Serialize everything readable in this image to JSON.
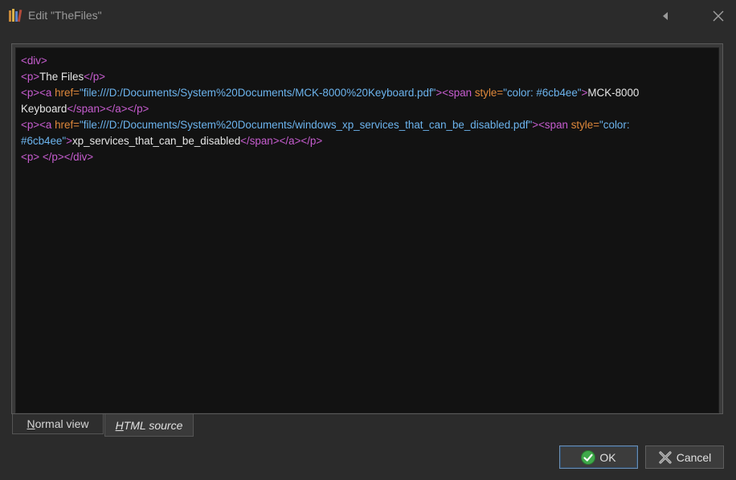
{
  "window": {
    "title": "Edit \"TheFiles\"",
    "icons": {
      "app": "bookshelf-icon",
      "collapse": "triangle-left-icon",
      "close": "close-icon"
    }
  },
  "source_lines": [
    [
      {
        "t": "tag",
        "v": "<div>"
      }
    ],
    [
      {
        "t": "tag",
        "v": "<p>"
      },
      {
        "t": "txt",
        "v": "The Files"
      },
      {
        "t": "tag",
        "v": "</p>"
      }
    ],
    [
      {
        "t": "tag",
        "v": "<p>"
      },
      {
        "t": "tag",
        "v": "<a "
      },
      {
        "t": "attr",
        "v": "href="
      },
      {
        "t": "val",
        "v": "\"file:///D:/Documents/System%20Documents/MCK-8000%20Keyboard.pdf\""
      },
      {
        "t": "tag",
        "v": ">"
      },
      {
        "t": "tag",
        "v": "<span "
      },
      {
        "t": "attr",
        "v": "style="
      },
      {
        "t": "val",
        "v": "\"color: #6cb4ee\""
      },
      {
        "t": "tag",
        "v": ">"
      },
      {
        "t": "txt",
        "v": "MCK-8000"
      }
    ],
    [
      {
        "t": "txt",
        "v": "Keyboard"
      },
      {
        "t": "tag",
        "v": "</span>"
      },
      {
        "t": "tag",
        "v": "</a>"
      },
      {
        "t": "tag",
        "v": "</p>"
      }
    ],
    [
      {
        "t": "tag",
        "v": "<p>"
      },
      {
        "t": "tag",
        "v": "<a "
      },
      {
        "t": "attr",
        "v": "href="
      },
      {
        "t": "val",
        "v": "\"file:///D:/Documents/System%20Documents/windows_xp_services_that_can_be_disabled.pdf\""
      },
      {
        "t": "tag",
        "v": ">"
      },
      {
        "t": "tag",
        "v": "<span "
      },
      {
        "t": "attr",
        "v": "style="
      },
      {
        "t": "val",
        "v": "\"color:"
      }
    ],
    [
      {
        "t": "val",
        "v": "#6cb4ee\""
      },
      {
        "t": "tag",
        "v": ">"
      },
      {
        "t": "txt",
        "v": "xp_services_that_can_be_disabled"
      },
      {
        "t": "tag",
        "v": "</span>"
      },
      {
        "t": "tag",
        "v": "</a>"
      },
      {
        "t": "tag",
        "v": "</p>"
      }
    ],
    [
      {
        "t": "tag",
        "v": "<p>"
      },
      {
        "t": "txt",
        "v": " "
      },
      {
        "t": "tag",
        "v": "</p>"
      },
      {
        "t": "tag",
        "v": "</div>"
      }
    ]
  ],
  "tabs": {
    "normal_label": "Normal view",
    "normal_accel": "N",
    "normal_rest": "ormal view",
    "html_label": "HTML source",
    "html_accel": "H",
    "html_rest": "TML source"
  },
  "buttons": {
    "ok_label": "OK",
    "cancel_label": "Cancel",
    "ok_icon": "check-circle-icon",
    "cancel_icon": "x-cross-icon"
  },
  "colors": {
    "tag": "#c75dd0",
    "attr": "#e0893b",
    "value": "#6cb4ee",
    "text": "#e6e6e6",
    "editor_bg": "#121212"
  }
}
